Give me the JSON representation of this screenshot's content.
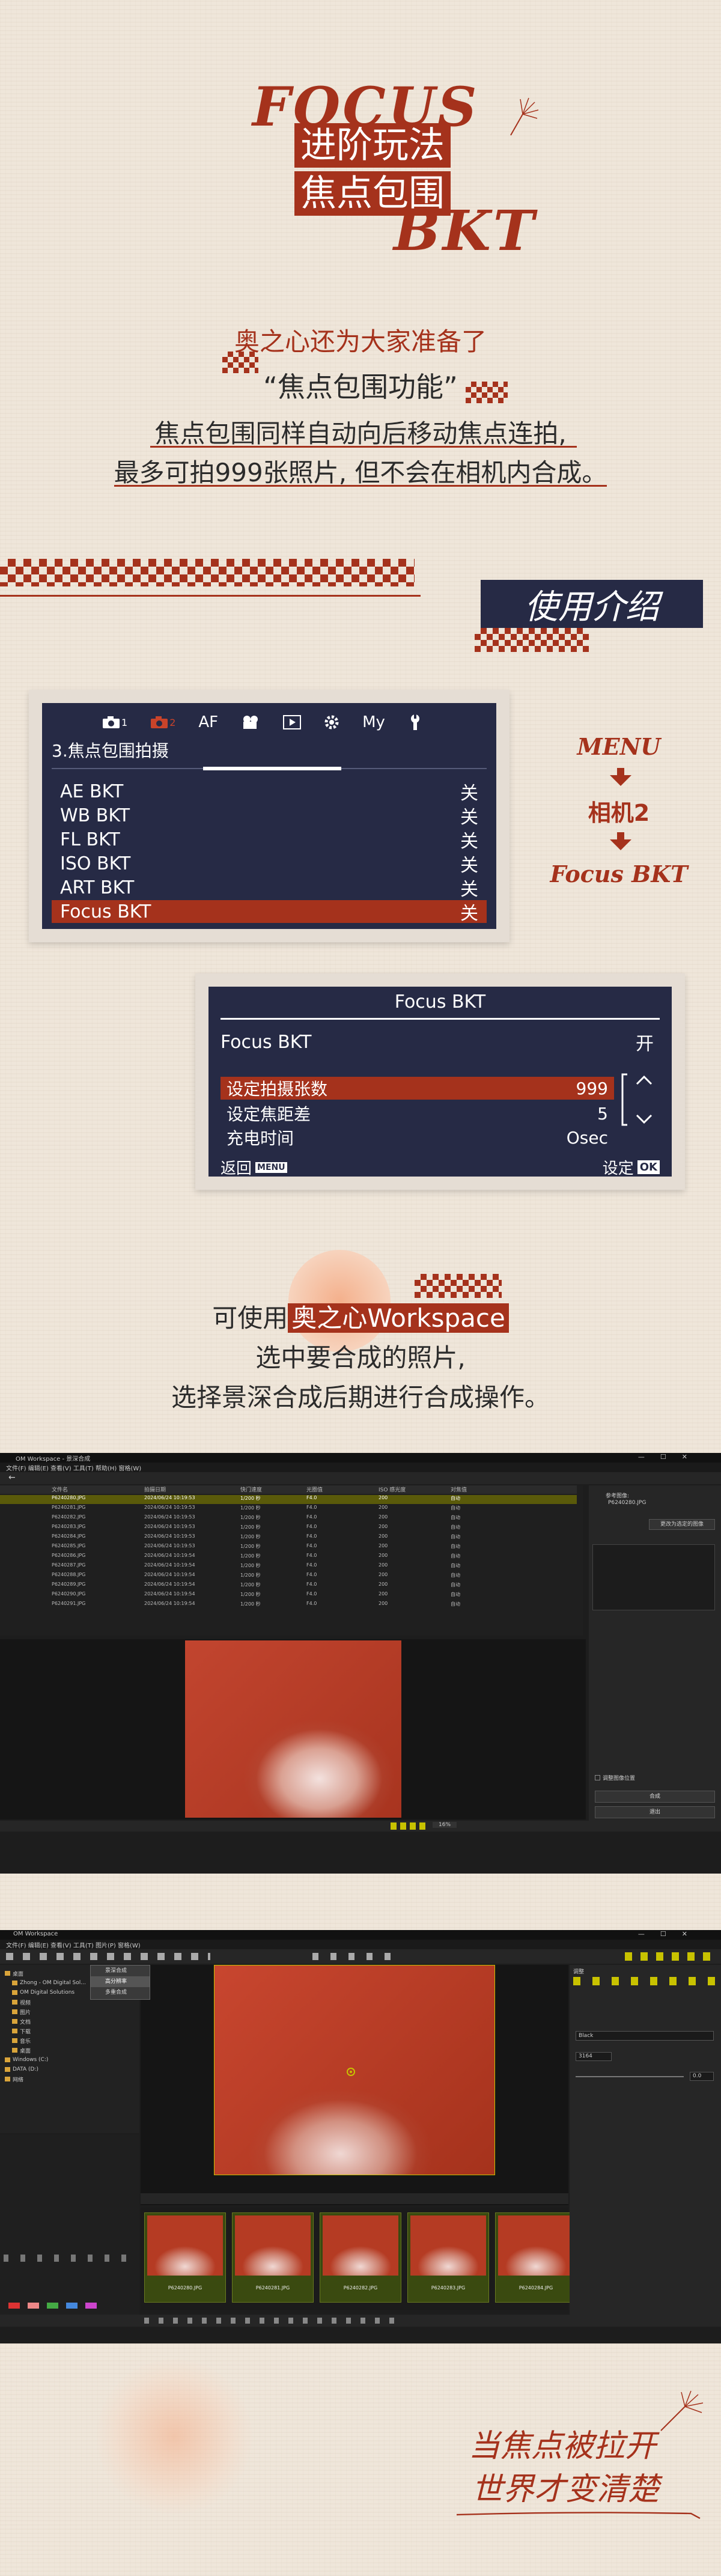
{
  "hero": {
    "title_focus": "FOCUS",
    "title_line1": "进阶玩法",
    "title_line2": "焦点包围",
    "title_bkt": "BKT"
  },
  "intro": {
    "line1": "奥之心还为大家准备了",
    "line2": "“焦点包围功能”",
    "line3": "焦点包围同样自动向后移动焦点连拍,",
    "line4": "最多可拍999张照片, 但不会在相机内合成。"
  },
  "usage": {
    "label": "使用介绍"
  },
  "menu_path": {
    "step1": "MENU",
    "step2": "相机2",
    "step3": "Focus BKT"
  },
  "camera_menu": {
    "tabs": [
      "1",
      "2",
      "AF",
      "My"
    ],
    "header": "3.焦点包围拍摄",
    "items": [
      {
        "label": "AE BKT",
        "value": "关"
      },
      {
        "label": "WB BKT",
        "value": "关"
      },
      {
        "label": "FL BKT",
        "value": "关"
      },
      {
        "label": "ISO BKT",
        "value": "关"
      },
      {
        "label": "ART BKT",
        "value": "关"
      },
      {
        "label": "Focus BKT",
        "value": "关"
      }
    ]
  },
  "focus_bkt_menu": {
    "title": "Focus BKT",
    "toggle_label": "Focus BKT",
    "toggle_value": "开",
    "rows": [
      {
        "label": "设定拍摄张数",
        "value": "999"
      },
      {
        "label": "设定焦距差",
        "value": "5"
      },
      {
        "label": "充电时间",
        "value": "Osec"
      }
    ],
    "back_label": "返回",
    "back_key": "MENU",
    "set_label": "设定",
    "set_key": "OK"
  },
  "workspace_text": {
    "line1_prefix": "可使用",
    "line1_highlight": "奥之心Workspace",
    "line2": "选中要合成的照片,",
    "line3": "选择景深合成后期进行合成操作。"
  },
  "screenshot1": {
    "window_title": "OM Workspace - 景深合成",
    "menubar": "文件(F)  编辑(E)  查看(V)  工具(T)  帮助(H)  窗格(W)",
    "columns": [
      "文件名",
      "拍摄日期",
      "快门速度",
      "光圈值",
      "ISO 感光度",
      "对焦值"
    ],
    "rows": [
      [
        "P6240280.JPG",
        "2024/06/24 10:19:53",
        "1/200 秒",
        "F4.0",
        "200",
        "自动"
      ],
      [
        "P6240281.JPG",
        "2024/06/24 10:19:53",
        "1/200 秒",
        "F4.0",
        "200",
        "自动"
      ],
      [
        "P6240282.JPG",
        "2024/06/24 10:19:53",
        "1/200 秒",
        "F4.0",
        "200",
        "自动"
      ],
      [
        "P6240283.JPG",
        "2024/06/24 10:19:53",
        "1/200 秒",
        "F4.0",
        "200",
        "自动"
      ],
      [
        "P6240284.JPG",
        "2024/06/24 10:19:53",
        "1/200 秒",
        "F4.0",
        "200",
        "自动"
      ],
      [
        "P6240285.JPG",
        "2024/06/24 10:19:53",
        "1/200 秒",
        "F4.0",
        "200",
        "自动"
      ],
      [
        "P6240286.JPG",
        "2024/06/24 10:19:54",
        "1/200 秒",
        "F4.0",
        "200",
        "自动"
      ],
      [
        "P6240287.JPG",
        "2024/06/24 10:19:54",
        "1/200 秒",
        "F4.0",
        "200",
        "自动"
      ],
      [
        "P6240288.JPG",
        "2024/06/24 10:19:54",
        "1/200 秒",
        "F4.0",
        "200",
        "自动"
      ],
      [
        "P6240289.JPG",
        "2024/06/24 10:19:54",
        "1/200 秒",
        "F4.0",
        "200",
        "自动"
      ],
      [
        "P6240290.JPG",
        "2024/06/24 10:19:54",
        "1/200 秒",
        "F4.0",
        "200",
        "自动"
      ],
      [
        "P6240291.JPG",
        "2024/06/24 10:19:54",
        "1/200 秒",
        "F4.0",
        "200",
        "自动"
      ]
    ],
    "side_label": "参考图像:",
    "side_file": "P6240280.JPG",
    "side_button": "更改为选定的图像",
    "side_checkbox": "调整图像位置",
    "start_button": "合成",
    "exit_button": "退出",
    "zoom": "16%"
  },
  "screenshot2": {
    "window_title": "OM Workspace",
    "menubar": "文件(F)  编辑(E)  查看(V)  工具(T)  图片(P)  窗格(W)",
    "popup_items": [
      "景深合成",
      "高分辨率",
      "多重合成"
    ],
    "tree_items": [
      "桌面",
      "Zhong - OM Digital Sol...",
      "OM Digital Solutions",
      "视频",
      "图片",
      "文档",
      "下载",
      "音乐",
      "桌面",
      "Windows (C:)",
      "DATA (D:)",
      "网络"
    ],
    "thumbs": [
      "P6240280.JPG",
      "P6240281.JPG",
      "P6240282.JPG",
      "P6240283.JPG",
      "P6240284.JPG"
    ],
    "right_header": "调整",
    "right_select": "Black",
    "right_value1": "3164",
    "right_value2": "0.0"
  },
  "footer": {
    "line1": "当焦点被拉开",
    "line2": "世界才变清楚"
  },
  "colors": {
    "accent": "#a5321c",
    "navy": "#262a45",
    "paper": "#efe6da"
  }
}
